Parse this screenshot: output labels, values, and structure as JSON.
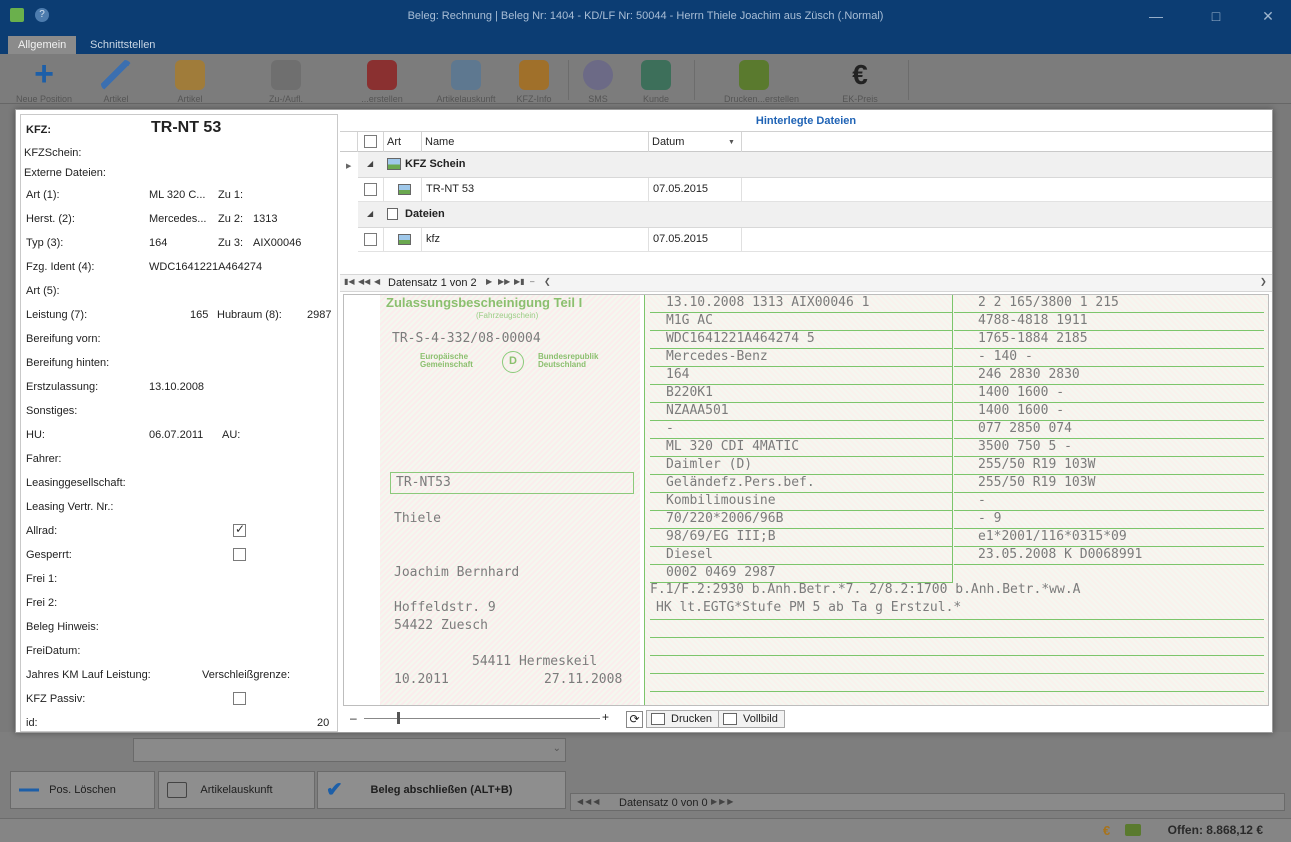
{
  "window": {
    "title": "Beleg: Rechnung | Beleg Nr: 1404 - KD/LF Nr: 50044 - Herrn Thiele Joachim aus Züsch (.Normal)"
  },
  "tabs": [
    {
      "label": "Allgemein",
      "active": true
    },
    {
      "label": "Schnittstellen",
      "active": false
    }
  ],
  "ribbon": {
    "buttons": [
      "Neue Position",
      "Artikel",
      "Artikel",
      "Zu-/Aufl.",
      "...erstellen",
      "Artikelauskunft",
      "KFZ-Info",
      "SMS",
      "Kunde",
      "Drucken...erstellen",
      "EK-Preis"
    ]
  },
  "left_panel": {
    "kfz_label": "KFZ:",
    "kfz_value": "TR-NT 53",
    "kfzschein_label": "KFZSchein:",
    "externe_label": "Externe Dateien:",
    "art1_label": "Art (1):",
    "art1_value": "ML 320 C...",
    "zu1_label": "Zu 1:",
    "zu1_value": "",
    "herst_label": "Herst. (2):",
    "herst_value": "Mercedes...",
    "zu2_label": "Zu 2:",
    "zu2_value": "1313",
    "typ_label": "Typ (3):",
    "typ_value": "164",
    "zu3_label": "Zu 3:",
    "zu3_value": "AIX00046",
    "fzg_label": "Fzg. Ident (4):",
    "fzg_value": "WDC1641221A464274",
    "art5_label": "Art (5):",
    "leistung_label": "Leistung (7):",
    "leistung_value": "165",
    "hubraum_label": "Hubraum (8):",
    "hubraum_value": "2987",
    "bereif_vorn_label": "Bereifung vorn:",
    "bereif_hinten_label": "Bereifung hinten:",
    "erstzul_label": "Erstzulassung:",
    "erstzul_value": "13.10.2008",
    "sonstiges_label": "Sonstiges:",
    "hu_label": "HU:",
    "hu_value": "06.07.2011",
    "au_label": "AU:",
    "fahrer_label": "Fahrer:",
    "leasing_label": "Leasinggesellschaft:",
    "leasing_nr_label": "Leasing Vertr. Nr.:",
    "allrad_label": "Allrad:",
    "allrad_checked": true,
    "gesperrt_label": "Gesperrt:",
    "gesperrt_checked": false,
    "frei1_label": "Frei 1:",
    "frei2_label": "Frei 2:",
    "hinweis_label": "Beleg Hinweis:",
    "freidatum_label": "FreiDatum:",
    "jahres_label": "Jahres KM Lauf Leistung:",
    "verschleiss_label": "Verschleißgrenze:",
    "passiv_label": "KFZ Passiv:",
    "passiv_checked": false,
    "id_label": "id:",
    "id_value": "20"
  },
  "right_panel": {
    "header": "Hinterlegte Dateien",
    "columns": [
      "Art",
      "Name",
      "Datum"
    ],
    "groups": [
      {
        "name": "KFZ Schein",
        "rows": [
          {
            "name": "TR-NT 53",
            "date": "07.05.2015"
          }
        ]
      },
      {
        "name": "Dateien",
        "rows": [
          {
            "name": "kfz",
            "date": "07.05.2015"
          }
        ]
      }
    ],
    "navigator": "Datensatz 1 von 2",
    "print_label": "Drucken",
    "fullscreen_label": "Vollbild"
  },
  "document": {
    "title": "Zulassungsbescheinigung Teil I",
    "subtitle": "(Fahrzeugschein)",
    "nr": "TR-S-4-332/08-00004",
    "eu_left": "Europäische Gemeinschaft",
    "eu_right": "Bundesrepublik Deutschland",
    "country": "D",
    "kennzeichen": "TR-NT53",
    "name": "Thiele",
    "vorname": "Joachim Bernhard",
    "strasse": "Hoffeldstr. 9",
    "ort": "54422 Zuesch",
    "stelle": "54411 Hermeskeil",
    "hu": "10.2011",
    "datum": "27.11.2008",
    "rows": [
      "13.10.2008  1313  AIX00046 1",
      "M1G                AC",
      "WDC1641221A464274     5",
      "Mercedes-Benz",
      "164",
      "B220K1",
      "NZAAA501",
      "-",
      "ML 320 CDI 4MATIC",
      "Daimler (D)",
      "Geländefz.Pers.bef.",
      "Kombilimousine",
      "70/220*2006/96B",
      "98/69/EG III;B",
      "Diesel",
      "0002     0469     2987"
    ],
    "rows_right": [
      "2   2   165/3800  1  215",
      "4788-4818       1911",
      "1765-1884       2185",
      "-        140       -",
      "246      2830      2830",
      "1400     1600       -",
      "1400     1600       -",
      "077      2850      074",
      "3500     750    5    -",
      "255/50 R19 103W",
      "255/50 R19 103W",
      "-",
      "-                    9",
      "e1*2001/116*0315*09",
      "23.05.2008   K  D0068991"
    ],
    "note1": "F.1/F.2:2930 b.Anh.Betr.*7. 2/8.2:1700 b.Anh.Betr.*ww.A",
    "note2": "HK lt.EGTG*Stufe PM 5 ab Ta g Erstzul.*"
  },
  "background": {
    "btn_loeschen": "Pos. Löschen",
    "btn_artikel": "Artikelauskunft",
    "btn_abschliessen": "Beleg abschließen (ALT+B)",
    "nav_lower": "Datensatz 0 von 0",
    "offen": "Offen: 8.868,12 €"
  }
}
